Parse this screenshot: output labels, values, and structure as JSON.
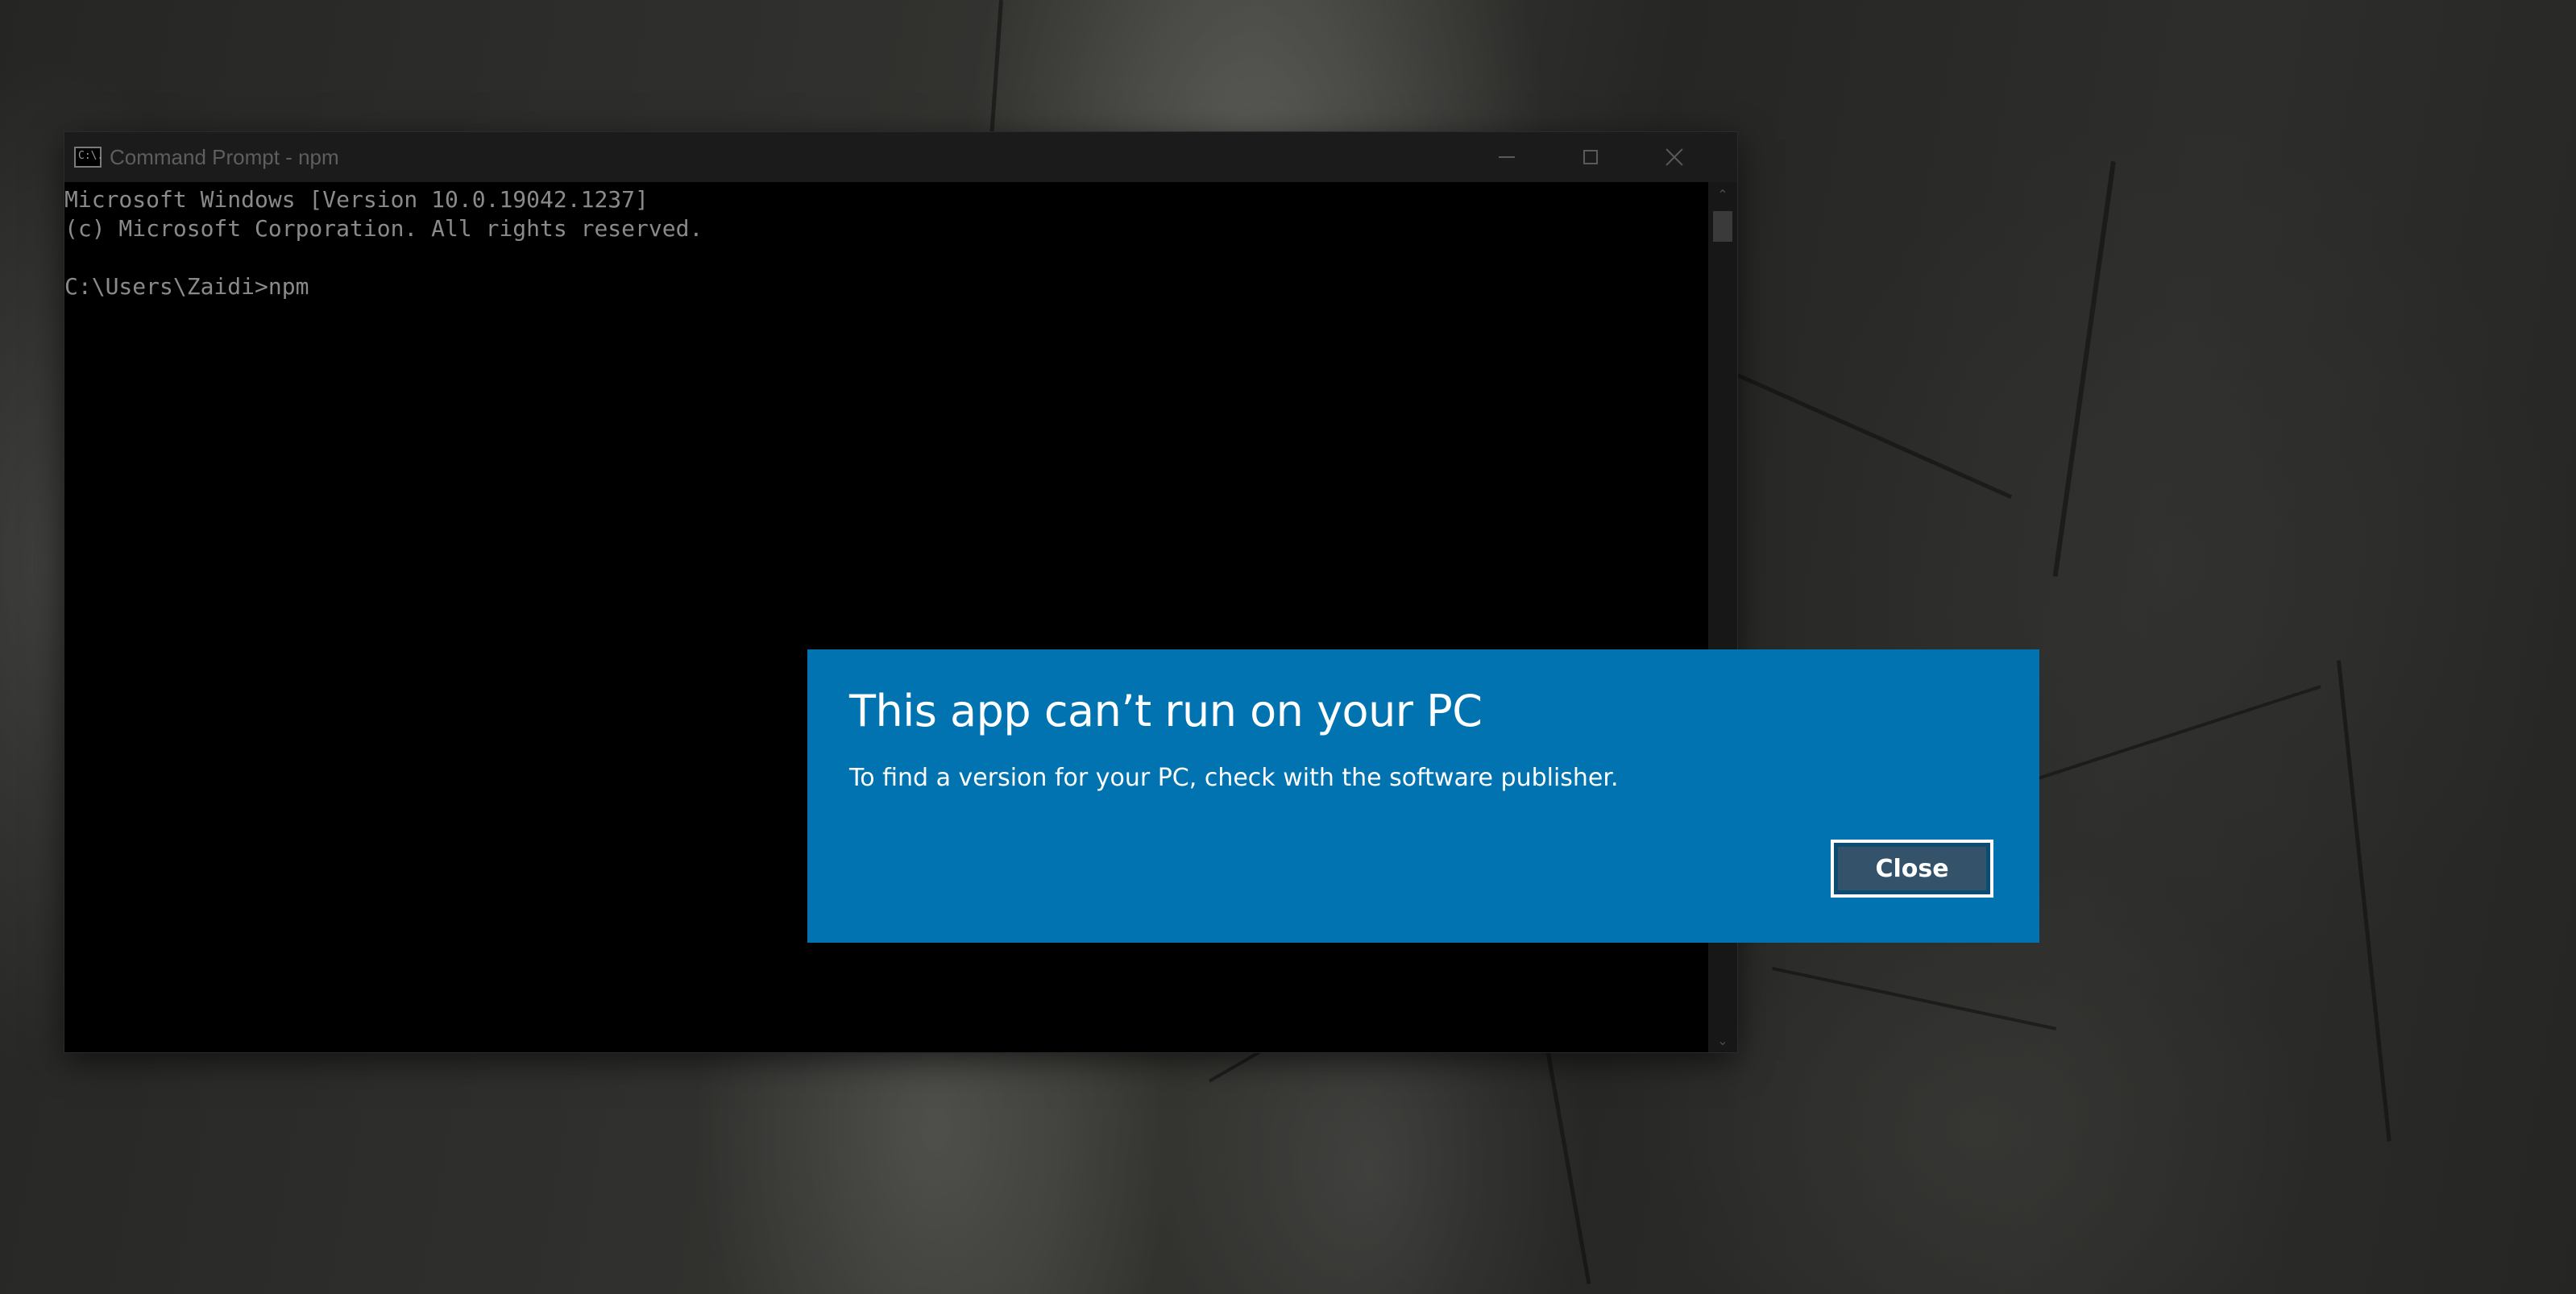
{
  "desktop": {
    "wallpaper": "rock-cliff-wallpaper"
  },
  "cmd_window": {
    "title": "Command Prompt - npm",
    "icon": "cmd-icon",
    "icon_text": "C:\\.",
    "controls": {
      "minimize": "minimize-icon",
      "maximize": "maximize-icon",
      "close": "close-icon"
    },
    "console_lines": [
      "Microsoft Windows [Version 10.0.19042.1237]",
      "(c) Microsoft Corporation. All rights reserved.",
      "",
      "C:\\Users\\Zaidi>npm"
    ],
    "colors": {
      "console_bg": "#000000",
      "console_text": "#8a8a8a",
      "titlebar_bg": "#1b1b1b"
    }
  },
  "dialog": {
    "title": "This app can’t run on your PC",
    "message": "To find a version for your PC, check with the software publisher.",
    "close_label": "Close",
    "colors": {
      "background": "#0173b1",
      "text": "#ffffff"
    }
  }
}
